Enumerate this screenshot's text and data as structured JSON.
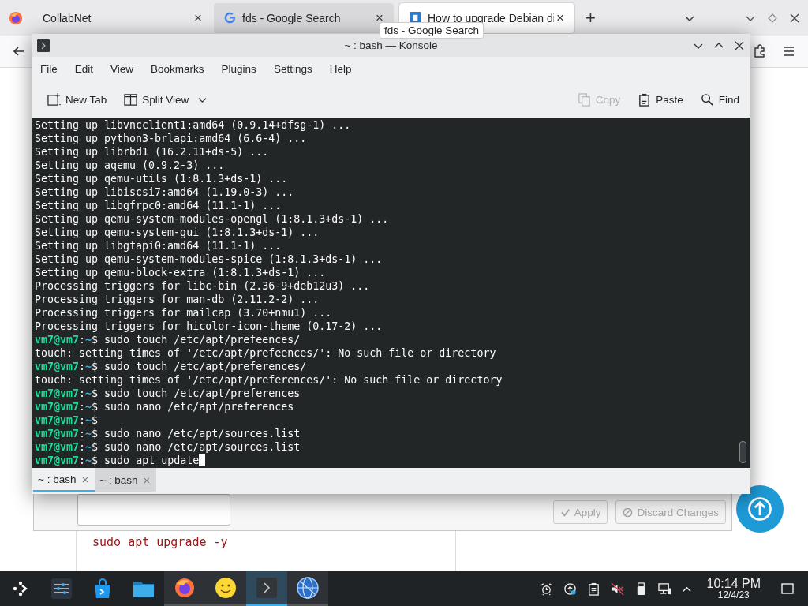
{
  "browser": {
    "tabs": [
      {
        "title": "CollabNet",
        "kind": "plain",
        "selected": false,
        "hovered": false,
        "close": "×"
      },
      {
        "title": "fds - Google Search",
        "kind": "google",
        "selected": false,
        "hovered": true,
        "close": "×"
      },
      {
        "title": "How to upgrade Debian di",
        "kind": "doc",
        "selected": true,
        "hovered": false,
        "close": "×"
      }
    ],
    "new_tab": "+",
    "tooltip": "fds - Google Search"
  },
  "page": {
    "buttons": [
      {
        "label": "Apply",
        "kind": "apply",
        "disabled": true
      },
      {
        "label": "Discard Changes",
        "kind": "discard",
        "disabled": true
      }
    ],
    "code": "sudo apt upgrade -y"
  },
  "konsole": {
    "title": "~ : bash — Konsole",
    "menu": [
      "File",
      "Edit",
      "View",
      "Bookmarks",
      "Plugins",
      "Settings",
      "Help"
    ],
    "toolbar_left": [
      {
        "label": "New Tab",
        "kind": "new-tab",
        "disabled": false
      },
      {
        "label": "Split View",
        "kind": "split",
        "disabled": false
      }
    ],
    "toolbar_right": [
      {
        "label": "Copy",
        "kind": "copy",
        "disabled": true
      },
      {
        "label": "Paste",
        "kind": "paste",
        "disabled": false
      },
      {
        "label": "Find",
        "kind": "find",
        "disabled": false
      }
    ],
    "lines": [
      {
        "kind": "output",
        "text": "Setting up libvncclient1:amd64 (0.9.14+dfsg-1) ..."
      },
      {
        "kind": "output",
        "text": "Setting up python3-brlapi:amd64 (6.6-4) ..."
      },
      {
        "kind": "output",
        "text": "Setting up librbd1 (16.2.11+ds-5) ..."
      },
      {
        "kind": "output",
        "text": "Setting up aqemu (0.9.2-3) ..."
      },
      {
        "kind": "output",
        "text": "Setting up qemu-utils (1:8.1.3+ds-1) ..."
      },
      {
        "kind": "output",
        "text": "Setting up libiscsi7:amd64 (1.19.0-3) ..."
      },
      {
        "kind": "output",
        "text": "Setting up libgfrpc0:amd64 (11.1-1) ..."
      },
      {
        "kind": "output",
        "text": "Setting up qemu-system-modules-opengl (1:8.1.3+ds-1) ..."
      },
      {
        "kind": "output",
        "text": "Setting up qemu-system-gui (1:8.1.3+ds-1) ..."
      },
      {
        "kind": "output",
        "text": "Setting up libgfapi0:amd64 (11.1-1) ..."
      },
      {
        "kind": "output",
        "text": "Setting up qemu-system-modules-spice (1:8.1.3+ds-1) ..."
      },
      {
        "kind": "output",
        "text": "Setting up qemu-block-extra (1:8.1.3+ds-1) ..."
      },
      {
        "kind": "output",
        "text": "Processing triggers for libc-bin (2.36-9+deb12u3) ..."
      },
      {
        "kind": "output",
        "text": "Processing triggers for man-db (2.11.2-2) ..."
      },
      {
        "kind": "output",
        "text": "Processing triggers for mailcap (3.70+nmu1) ..."
      },
      {
        "kind": "output",
        "text": "Processing triggers for hicolor-icon-theme (0.17-2) ..."
      },
      {
        "kind": "prompt",
        "user": "vm7@vm7",
        "sep": ":",
        "path": "~",
        "sign": "$",
        "command": "sudo touch /etc/apt/prefeences/",
        "cursor": false
      },
      {
        "kind": "output",
        "text": "touch: setting times of '/etc/apt/prefeences/': No such file or directory"
      },
      {
        "kind": "prompt",
        "user": "vm7@vm7",
        "sep": ":",
        "path": "~",
        "sign": "$",
        "command": "sudo touch /etc/apt/preferences/",
        "cursor": false
      },
      {
        "kind": "output",
        "text": "touch: setting times of '/etc/apt/preferences/': No such file or directory"
      },
      {
        "kind": "prompt",
        "user": "vm7@vm7",
        "sep": ":",
        "path": "~",
        "sign": "$",
        "command": "sudo touch /etc/apt/preferences",
        "cursor": false
      },
      {
        "kind": "prompt",
        "user": "vm7@vm7",
        "sep": ":",
        "path": "~",
        "sign": "$",
        "command": "sudo nano /etc/apt/preferences",
        "cursor": false
      },
      {
        "kind": "prompt",
        "user": "vm7@vm7",
        "sep": ":",
        "path": "~",
        "sign": "$",
        "cursor": false
      },
      {
        "kind": "prompt",
        "user": "vm7@vm7",
        "sep": ":",
        "path": "~",
        "sign": "$",
        "command": "sudo nano /etc/apt/sources.list",
        "cursor": false
      },
      {
        "kind": "prompt",
        "user": "vm7@vm7",
        "sep": ":",
        "path": "~",
        "sign": "$",
        "command": "sudo nano /etc/apt/sources.list",
        "cursor": false
      },
      {
        "kind": "prompt",
        "user": "vm7@vm7",
        "sep": ":",
        "path": "~",
        "sign": "$",
        "command": "sudo apt update",
        "cursor": true
      }
    ],
    "tabs": [
      {
        "label": "~ : bash",
        "selected": true,
        "close": "×"
      },
      {
        "label": "~ : bash",
        "selected": false,
        "close": "×"
      }
    ]
  },
  "taskbar": {
    "apps": [
      {
        "kind": "launcher",
        "running": false,
        "active": false
      },
      {
        "kind": "settings",
        "running": false,
        "active": false
      },
      {
        "kind": "store",
        "running": false,
        "active": false
      },
      {
        "kind": "folder",
        "running": false,
        "active": false
      },
      {
        "kind": "firefox",
        "running": true,
        "active": false
      },
      {
        "kind": "smiley",
        "running": true,
        "active": false
      },
      {
        "kind": "terminal",
        "running": true,
        "active": true
      },
      {
        "kind": "globe",
        "running": true,
        "active": false
      }
    ],
    "clock": {
      "time": "10:14 PM",
      "date": "12/4/23"
    }
  }
}
